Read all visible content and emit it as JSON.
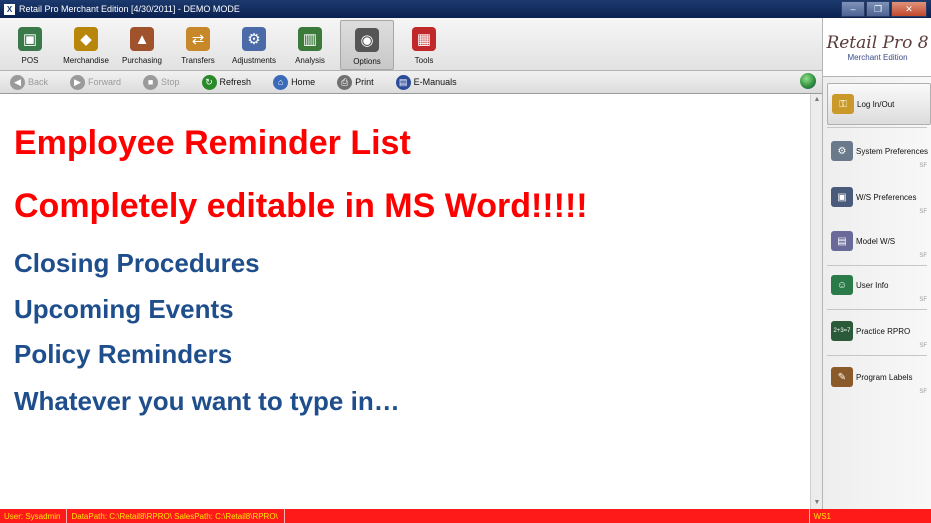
{
  "window": {
    "title": "Retail Pro Merchant Edition [4/30/2011] - DEMO MODE",
    "app_icon": "X",
    "controls": {
      "minimize": "–",
      "maximize": "❐",
      "close": "✕"
    }
  },
  "main_menu": [
    {
      "label": "POS",
      "icon": "pos-register-icon",
      "color": "#3a7a4a",
      "glyph": "▣"
    },
    {
      "label": "Merchandise",
      "icon": "merchandise-icon",
      "color": "#b8860b",
      "glyph": "◆"
    },
    {
      "label": "Purchasing",
      "icon": "purchasing-icon",
      "color": "#a0522d",
      "glyph": "▲"
    },
    {
      "label": "Transfers",
      "icon": "transfers-icon",
      "color": "#c7882a",
      "glyph": "⇄"
    },
    {
      "label": "Adjustments",
      "icon": "adjustments-icon",
      "color": "#4a6aa8",
      "glyph": "⚙"
    },
    {
      "label": "Analysis",
      "icon": "analysis-icon",
      "color": "#3b7a3b",
      "glyph": "▥"
    },
    {
      "label": "Options",
      "icon": "options-icon",
      "color": "#555555",
      "glyph": "◉",
      "active": true
    },
    {
      "label": "Tools",
      "icon": "tools-icon",
      "color": "#c0282a",
      "glyph": "▦"
    }
  ],
  "logo": {
    "main": "Retail Pro 8",
    "sub": "Merchant Edition"
  },
  "toolbar": [
    {
      "label": "Back",
      "icon": "back-arrow-icon",
      "color": "#9a9a9a",
      "glyph": "◀",
      "disabled": true
    },
    {
      "label": "Forward",
      "icon": "forward-arrow-icon",
      "color": "#9a9a9a",
      "glyph": "▶",
      "disabled": true
    },
    {
      "label": "Stop",
      "icon": "stop-icon",
      "color": "#9a9a9a",
      "glyph": "■",
      "disabled": true
    },
    {
      "label": "Refresh",
      "icon": "refresh-icon",
      "color": "#2a8a2a",
      "glyph": "↻",
      "disabled": false
    },
    {
      "label": "Home",
      "icon": "home-icon",
      "color": "#3a6ab8",
      "glyph": "⌂",
      "disabled": false
    },
    {
      "label": "Print",
      "icon": "printer-icon",
      "color": "#707070",
      "glyph": "⎙",
      "disabled": false
    },
    {
      "label": "E-Manuals",
      "icon": "e-manuals-icon",
      "color": "#2a4a9a",
      "glyph": "▤",
      "disabled": false
    }
  ],
  "document": {
    "lines": [
      {
        "text": "Employee Reminder List",
        "style": "red"
      },
      {
        "text": "Completely editable in MS Word!!!!!",
        "style": "red"
      },
      {
        "text": "Closing Procedures",
        "style": "blue"
      },
      {
        "text": "Upcoming Events",
        "style": "blue"
      },
      {
        "text": "Policy Reminders",
        "style": "blue"
      },
      {
        "text": "Whatever you want to type in…",
        "style": "blue"
      }
    ],
    "colors": {
      "red": "#ff0000",
      "blue": "#1f4e8c"
    }
  },
  "side_panel": [
    {
      "label": "Log In/Out",
      "icon": "login-keys-icon",
      "color": "#c99a2a",
      "glyph": "⚿",
      "highlight": true
    },
    {
      "label": "System Preferences",
      "icon": "system-preferences-icon",
      "color": "#6a7a8a",
      "glyph": "⚙",
      "tag": "SF"
    },
    {
      "label": "W/S Preferences",
      "icon": "workstation-preferences-icon",
      "color": "#4a5a7a",
      "glyph": "▣",
      "tag": "SF"
    },
    {
      "label": "Model W/S",
      "icon": "model-workstation-icon",
      "color": "#6a6a9a",
      "glyph": "▤",
      "tag": "SF"
    },
    {
      "label": "User Info",
      "icon": "user-info-icon",
      "color": "#2a7a4a",
      "glyph": "☺",
      "tag": "SF"
    },
    {
      "label": "Practice RPRO",
      "icon": "practice-chalkboard-icon",
      "color": "#2a5a3a",
      "glyph": "2+3=7",
      "tag": "SF"
    },
    {
      "label": "Program Labels",
      "icon": "program-labels-icon",
      "color": "#8a5a2a",
      "glyph": "✎",
      "tag": "SF"
    }
  ],
  "status": {
    "user": "User: Sysadmin",
    "paths": "DataPath: C:\\Retail8\\RPRO\\ SalesPath: C:\\Retail8\\RPRO\\",
    "workstation": "WS1"
  }
}
